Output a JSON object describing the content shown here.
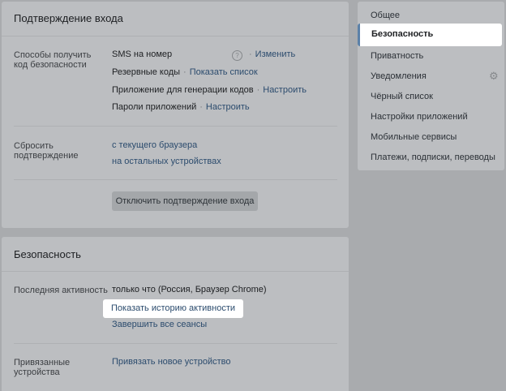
{
  "confirm": {
    "title": "Подтверждение входа",
    "methods_label": "Способы получить код безопасности",
    "methods": [
      {
        "name": "SMS на номер",
        "link": "Изменить"
      },
      {
        "name": "Резервные коды",
        "link": "Показать список"
      },
      {
        "name": "Приложение для генерации кодов",
        "link": "Настроить"
      },
      {
        "name": "Пароли приложений",
        "link": "Настроить"
      }
    ],
    "help_icon": "?",
    "reset_label": "Сбросить подтверждение",
    "reset_links": [
      "с текущего браузера",
      "на остальных устройствах"
    ],
    "disable_button": "Отключить подтверждение входа"
  },
  "security": {
    "title": "Безопасность",
    "activity_label": "Последняя активность",
    "activity_value": "только что (Россия, Браузер Chrome)",
    "history_link": "Показать историю активности",
    "end_sessions_link": "Завершить все сеансы",
    "devices_label": "Привязанные устройства",
    "devices_link": "Привязать новое устройство"
  },
  "menu": {
    "items": [
      "Общее",
      "Безопасность",
      "Приватность",
      "Уведомления",
      "Чёрный список",
      "Настройки приложений",
      "Мобильные сервисы",
      "Платежи, подписки, переводы"
    ],
    "active": "Безопасность",
    "gear_icon": "gear-icon"
  },
  "colors": {
    "overlay_background": "#a9abae",
    "link": "#2b4b6d",
    "highlight": "#ffffff",
    "active_marker": "#5b81a8"
  }
}
